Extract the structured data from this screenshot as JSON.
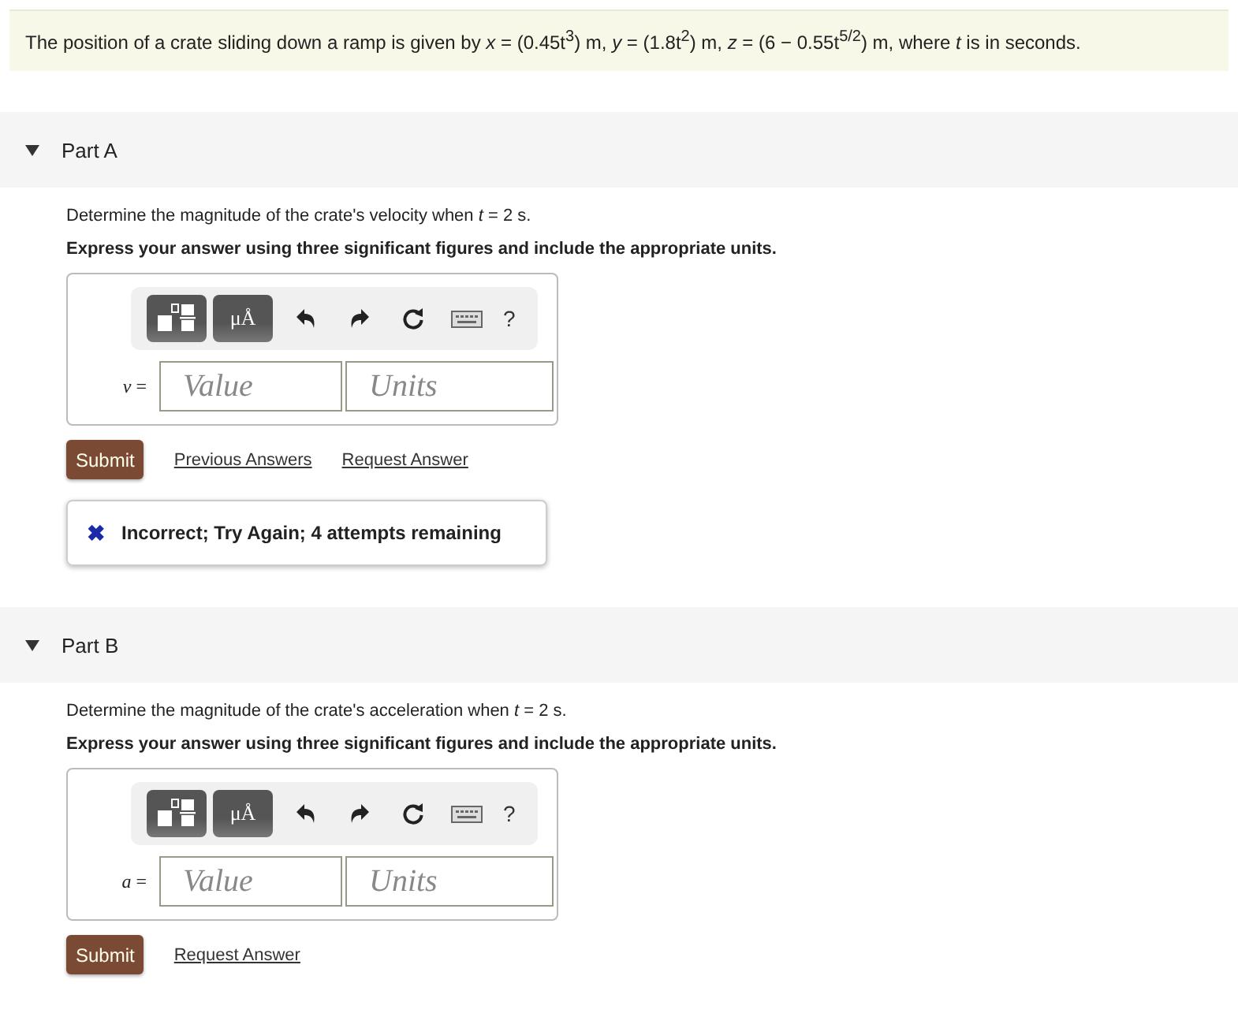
{
  "intro": "The position of a crate sliding down a ramp is given by *x* = (0.45t$^{3}$) m, *y* = (1.8t$^{2}$) m, *z* = (6 − 0.55t$^{5/2}$) m, where *t* is in seconds.",
  "parts": [
    {
      "title": "Part A",
      "expanded": true,
      "question": "Determine the magnitude of the crate's velocity when *t* = 2 s.",
      "instruction": "Express your answer using three significant figures and include the appropriate units.",
      "units_button": "μÅ",
      "help": "?",
      "variable": "*v* =",
      "value_placeholder": "Value",
      "units_placeholder": "Units",
      "submit": "Submit",
      "links": [
        "Previous Answers",
        "Request Answer"
      ],
      "feedback": {
        "kind": "incorrect",
        "icon": "✖",
        "text": "Incorrect; Try Again; 4 attempts remaining"
      }
    },
    {
      "title": "Part B",
      "expanded": true,
      "question": "Determine the magnitude of the crate's acceleration when *t* = 2 s.",
      "instruction": "Express your answer using three significant figures and include the appropriate units.",
      "units_button": "μÅ",
      "help": "?",
      "variable": "*a* =",
      "value_placeholder": "Value",
      "units_placeholder": "Units",
      "submit": "Submit",
      "links": [
        "Request Answer"
      ]
    }
  ]
}
